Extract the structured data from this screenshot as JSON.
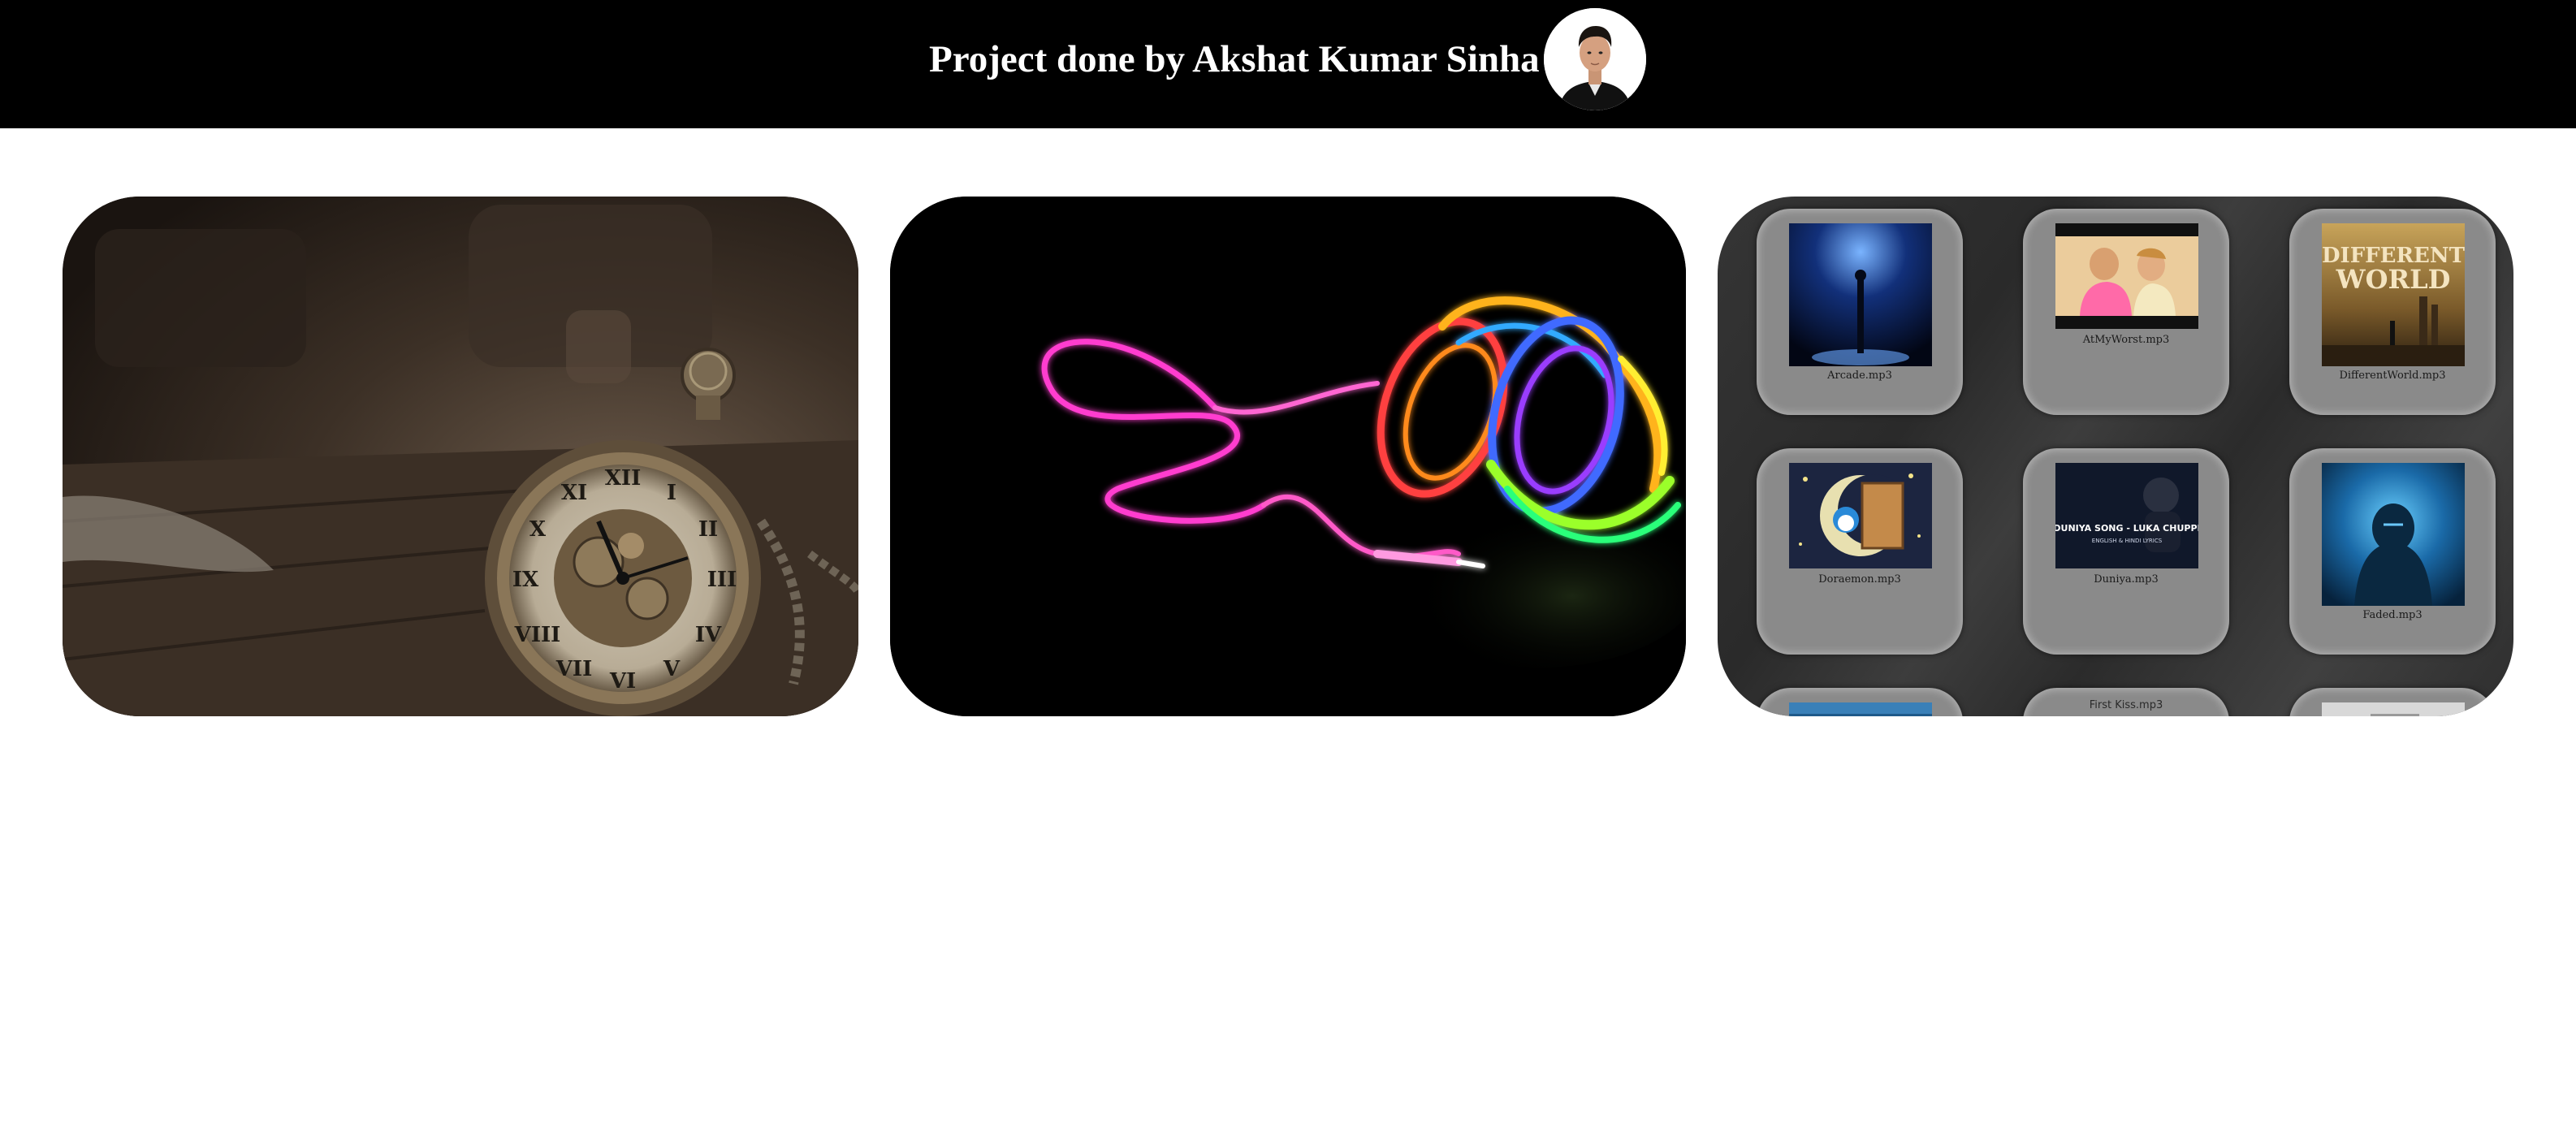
{
  "header": {
    "title": "Project done by Akshat Kumar Sinha",
    "avatar_icon": "person-avatar-icon"
  },
  "panels": {
    "watch": {
      "icon": "pocket-watch-image"
    },
    "headphones": {
      "icon": "neon-headphones-image"
    }
  },
  "playlist": {
    "songs": [
      {
        "label": "Arcade.mp3"
      },
      {
        "label": "AtMyWorst.mp3"
      },
      {
        "label": "DifferentWorld.mp3"
      },
      {
        "label": "Doraemon.mp3"
      },
      {
        "label": "Duniya.mp3"
      },
      {
        "label": "Faded.mp3"
      },
      {
        "label": ""
      },
      {
        "label": "First Kiss.mp3"
      },
      {
        "label": ""
      }
    ],
    "thumbnail_text": {
      "different_world": "DIFFERENT WORLD",
      "duniya": "DUNIYA SONG - LUKA CHUPPI",
      "duniya_sub": "ENGLISH & HINDI LYRICS"
    }
  },
  "colors": {
    "header_bg": "#000000",
    "header_text": "#ffffff",
    "card_bg": "#8a8a8a",
    "music_panel_bg": "#2e2e2e"
  }
}
